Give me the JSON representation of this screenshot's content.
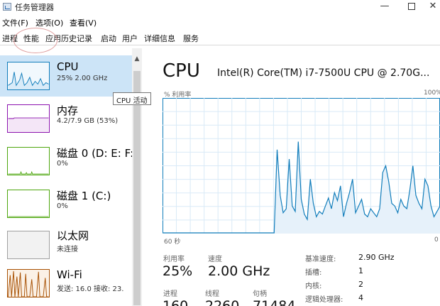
{
  "window": {
    "title": "任务管理器",
    "minimize": "—",
    "close": "✕"
  },
  "menu": [
    "文件(F)",
    "选项(O)",
    "查看(V)"
  ],
  "tabs": [
    "进程",
    "性能",
    "应用历史记录",
    "启动",
    "用户",
    "详细信息",
    "服务"
  ],
  "sidebar": {
    "items": [
      {
        "title": "CPU",
        "subtitle": "25%  2.00 GHz",
        "color": "#117dbb"
      },
      {
        "title": "内存",
        "subtitle": "4.2/7.9 GB (53%)",
        "color": "#8b12ae"
      },
      {
        "title": "磁盘 0 (D: E: F:)",
        "subtitle": "0%",
        "color": "#4da60c"
      },
      {
        "title": "磁盘 1 (C:)",
        "subtitle": "0%",
        "color": "#4da60c"
      },
      {
        "title": "以太网",
        "subtitle": "未连接",
        "color": "#a0a0a0"
      },
      {
        "title": "Wi-Fi",
        "subtitle": "发送: 16.0  接收: 23.",
        "color": "#a74f01"
      }
    ]
  },
  "tooltip": "CPU 活动",
  "main": {
    "title": "CPU",
    "model": "Intel(R) Core(TM) i7-7500U CPU @ 2.70G...",
    "chart_label": "% 利用率",
    "chart_max": "100%",
    "chart_time": "60 秒",
    "chart_min": "0",
    "graph_series": [
      0,
      0,
      0,
      0,
      0,
      0,
      0,
      0,
      0,
      0,
      0,
      0,
      0,
      0,
      0,
      0,
      0,
      0,
      0,
      0,
      0,
      0,
      0,
      0,
      0,
      0,
      0,
      0,
      0,
      0,
      0,
      0,
      0,
      0,
      0,
      0,
      0,
      0,
      62,
      28,
      15,
      18,
      55,
      20,
      16,
      68,
      25,
      14,
      10,
      40,
      22,
      12,
      16,
      14,
      20,
      26,
      18,
      30,
      24,
      35,
      12,
      22,
      30,
      40,
      15,
      20,
      25,
      14,
      12,
      18,
      15,
      12,
      18,
      45,
      50,
      38,
      22,
      20,
      15,
      25,
      20,
      18,
      32,
      50,
      28,
      22,
      18,
      40,
      35,
      20,
      12,
      16,
      20
    ],
    "stats": {
      "utilization_label": "利用率",
      "utilization": "25%",
      "speed_label": "速度",
      "speed": "2.00 GHz",
      "processes_label": "进程",
      "processes": "160",
      "threads_label": "线程",
      "threads": "2260",
      "handles_label": "句柄",
      "handles": "71484"
    },
    "details": [
      {
        "label": "基准速度:",
        "value": "2.90 GHz"
      },
      {
        "label": "插槽:",
        "value": "1"
      },
      {
        "label": "内核:",
        "value": "2"
      },
      {
        "label": "逻辑处理器:",
        "value": "4"
      }
    ]
  }
}
